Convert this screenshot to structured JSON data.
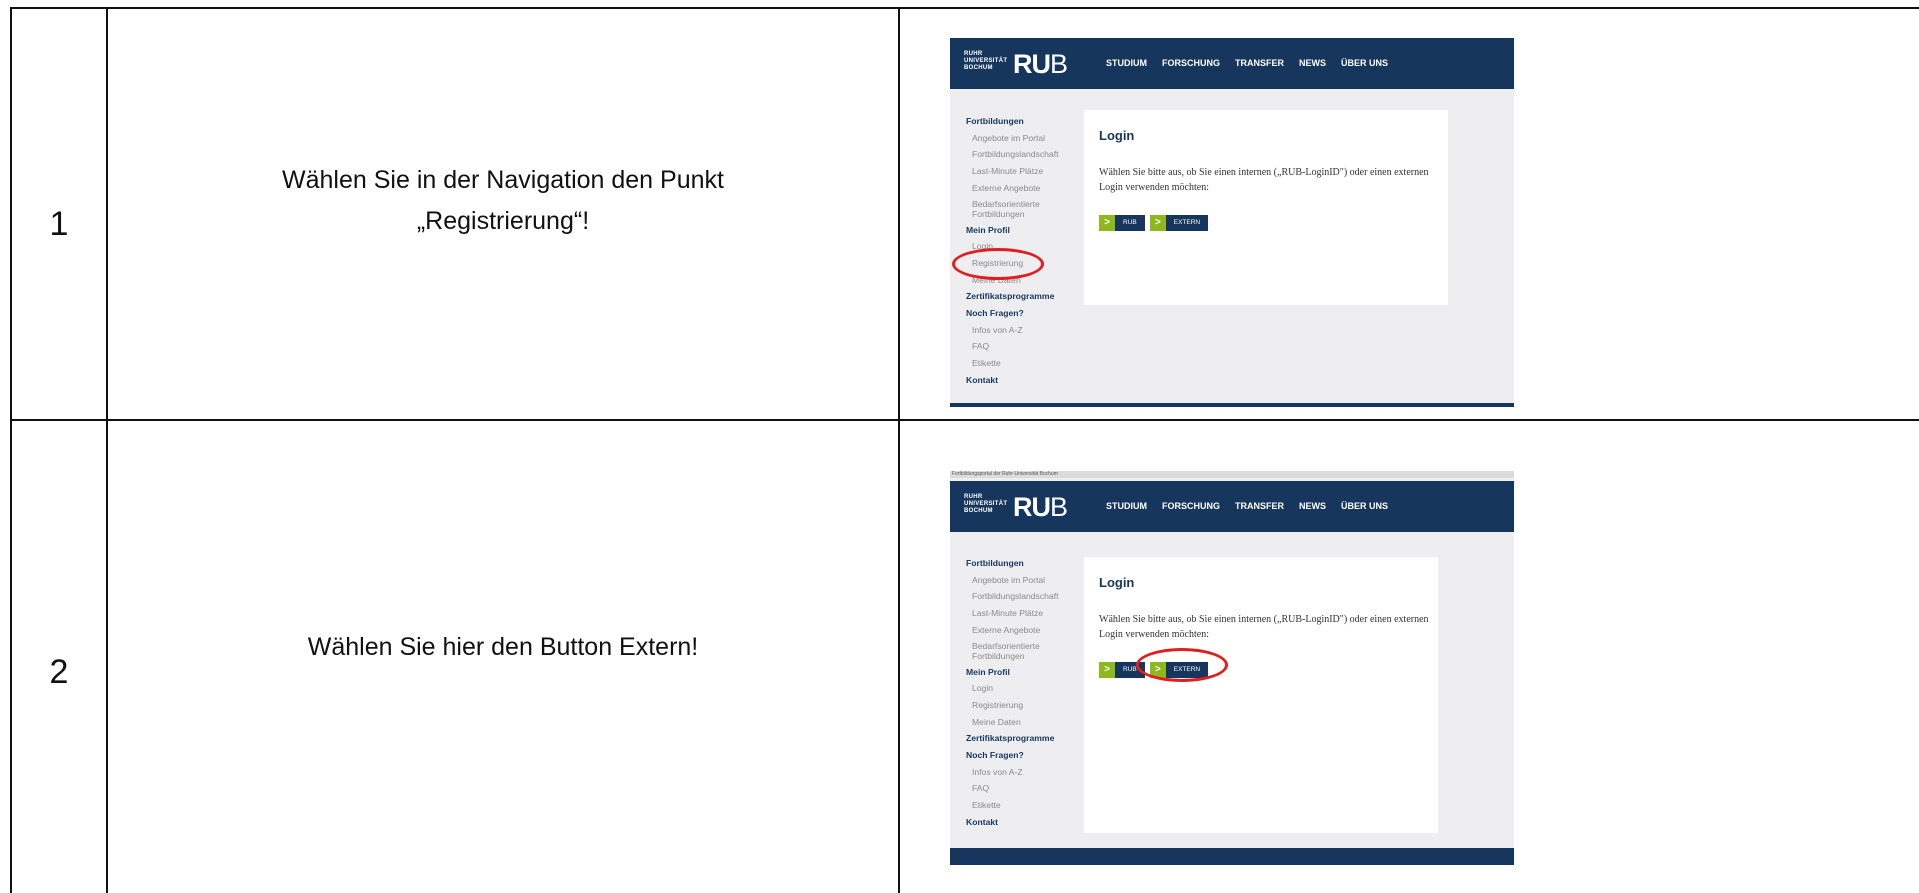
{
  "rows": [
    {
      "number": "1",
      "instruction_line1": "Wählen Sie in der Navigation den Punkt",
      "instruction_line2": "„Registrierung“!"
    },
    {
      "number": "2",
      "instruction_line1": "Wählen Sie hier den Button Extern!",
      "instruction_line2": ""
    }
  ],
  "portal": {
    "top_strip": "Fortbildungsportal der Ruhr-Universität Bochum",
    "brand_small_1": "RUHR",
    "brand_small_2": "UNIVERSITÄT",
    "brand_small_3": "BOCHUM",
    "brand_ru": "RU",
    "brand_b": "B",
    "nav": [
      "STUDIUM",
      "FORSCHUNG",
      "TRANSFER",
      "NEWS",
      "ÜBER UNS"
    ],
    "sidebar": {
      "h_fortbildungen": "Fortbildungen",
      "angebote_portal": "Angebote im Portal",
      "landschaft": "Fortbildungslandschaft",
      "last_minute": "Last-Minute Plätze",
      "externe": "Externe Angebote",
      "bedarfs": "Bedarfsorientierte Fortbildungen",
      "h_mein_profil": "Mein Profil",
      "login": "Login",
      "registrierung": "Registrierung",
      "meine_daten": "Meine Daten",
      "h_zertifikat": "Zertifikatsprogramme",
      "h_noch_fragen": "Noch Fragen?",
      "infos": "Infos von A-Z",
      "faq": "FAQ",
      "etikette": "Etikette",
      "h_kontakt": "Kontakt"
    },
    "login_title": "Login",
    "login_text": "Wählen Sie bitte aus, ob Sie einen internen („RUB-LoginID\") oder einen externen Login verwenden möchten:",
    "btn_arrow": ">",
    "btn_rub": "RUB",
    "btn_extern": "EXTERN"
  },
  "highlight_color": "#e01e1e",
  "brand_color": "#17365d",
  "accent_color": "#8fb81e"
}
